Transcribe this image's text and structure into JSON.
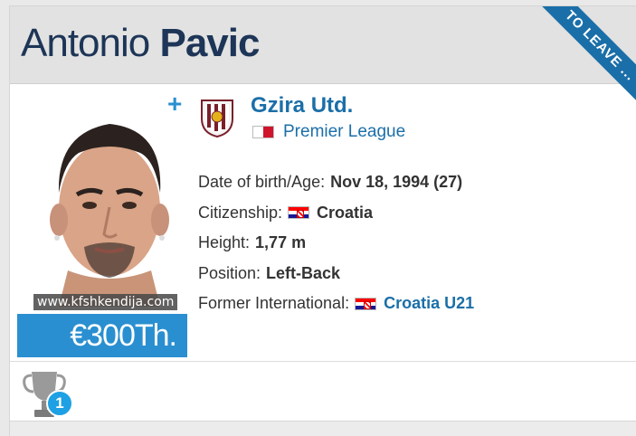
{
  "player": {
    "first_name": "Antonio",
    "last_name": "Pavic",
    "status_ribbon": "TO LEAVE ...",
    "market_value": "€300Th.",
    "watermark": "www.kfshkendija.com",
    "watchlist_symbol": "+"
  },
  "club": {
    "name": "Gzira Utd.",
    "league": "Premier League",
    "league_flag": "flag-malta-icon"
  },
  "details": [
    {
      "label": "Date of birth/Age:",
      "value": "Nov 18, 1994 (27)",
      "flag": "",
      "link": false
    },
    {
      "label": "Citizenship:",
      "value": "Croatia",
      "flag": "flag-croatia-icon",
      "link": false
    },
    {
      "label": "Height:",
      "value": "1,77 m",
      "flag": "",
      "link": false
    },
    {
      "label": "Position:",
      "value": "Left-Back",
      "flag": "",
      "link": false
    },
    {
      "label": "Former International:",
      "value": "Croatia U21",
      "flag": "flag-croatia-icon",
      "link": true
    }
  ],
  "achievements": {
    "icon": "trophy-icon",
    "count": "1"
  },
  "colors": {
    "accent": "#1b6fa8",
    "value_bg": "#2a8fd0",
    "name_color": "#1d3557",
    "badge": "#1ea0e4"
  }
}
